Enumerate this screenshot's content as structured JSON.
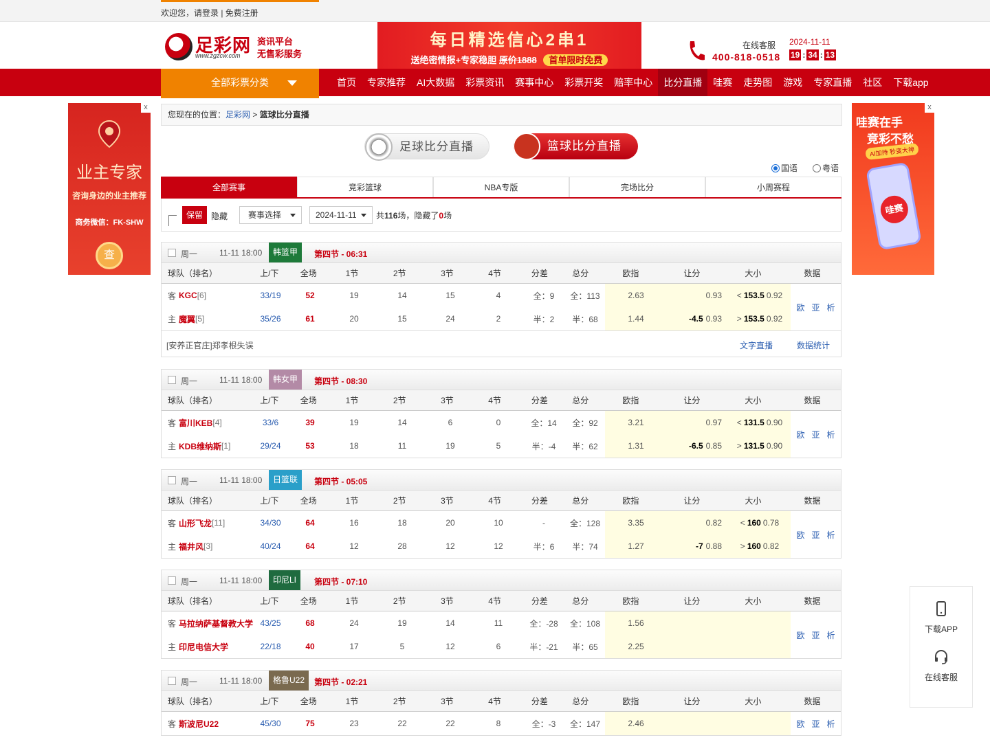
{
  "topbar": {
    "text": "欢迎您，请登录 | 免费注册"
  },
  "header": {
    "brand": "足彩网",
    "url": "www.zgzcw.com",
    "tag1": "资讯平台",
    "tag2": "无售彩服务",
    "banner_line1": "每日精选信心2串1",
    "banner_line2": "送绝密情报+专家稳胆",
    "banner_old_price": "原价1888",
    "banner_highlight": "首单限时免费",
    "service_label": "在线客服",
    "service_phone": "400-818-0518",
    "date": "2024-11-11",
    "clock_h": "19",
    "clock_m": "34",
    "clock_s": "13"
  },
  "nav": {
    "all_categories": "全部彩票分类",
    "items": [
      "首页",
      "专家推荐",
      "AI大数据",
      "彩票资讯",
      "赛事中心",
      "彩票开奖",
      "赔率中心",
      "比分直播",
      "哇赛",
      "走势图",
      "游戏",
      "专家直播",
      "社区",
      "下载app"
    ],
    "active_index": 7
  },
  "ad_left": {
    "close": "x",
    "title": "业主专家",
    "subtitle": "咨询身边的业主推荐",
    "wechat": "商务微信：FK-SHW",
    "coin": "查"
  },
  "ad_right": {
    "close": "x",
    "line1": "哇赛在手",
    "line2": "竞彩不愁",
    "line3": "AI加持 秒变大神",
    "app_logo": "哇赛"
  },
  "breadcrumb": {
    "prefix": "您现在的位置：",
    "home": "足彩网",
    "sep": ">",
    "current": "篮球比分直播"
  },
  "switches": {
    "football": "足球比分直播",
    "basketball": "篮球比分直播"
  },
  "radios": {
    "mandarin": "国语",
    "cantonese": "粤语"
  },
  "tabs": [
    "全部赛事",
    "竞彩篮球",
    "NBA专版",
    "完场比分",
    "小周赛程"
  ],
  "filter": {
    "keep": "保留",
    "hide": "隐藏",
    "event_select": "赛事选择",
    "date": "2024-11-11",
    "count_prefix": "共",
    "total": "116",
    "count_mid": "场，隐藏了",
    "hidden": "0",
    "count_suffix": "场"
  },
  "columns": [
    "球队（排名）",
    "上/下",
    "全场",
    "1节",
    "2节",
    "3节",
    "4节",
    "分差",
    "总分",
    "欧指",
    "让分",
    "大小",
    "数据"
  ],
  "data_links": [
    "欧",
    "亚",
    "析"
  ],
  "matches": [
    {
      "weekday": "周一",
      "time": "11-11 18:00",
      "league": "韩篮甲",
      "league_color": "#1e7a3a",
      "status": "第四节 - 06:31",
      "away": {
        "side": "客",
        "name": "KGC",
        "rank": "[6]",
        "ud": "33/19",
        "ft": "52",
        "q": [
          "19",
          "14",
          "15",
          "4"
        ],
        "diff": "全：9",
        "total": "全：113",
        "eu": "2.63",
        "rq_line": "",
        "rq_odds": "0.93",
        "dx_sign": "<",
        "dx_line": "153.5",
        "dx_odds": "0.92"
      },
      "home": {
        "side": "主",
        "name": "魔翼",
        "rank": "[5]",
        "ud": "35/26",
        "ft": "61",
        "q": [
          "20",
          "15",
          "24",
          "2"
        ],
        "diff": "半：2",
        "total": "半：68",
        "eu": "1.44",
        "rq_line": "-4.5",
        "rq_odds": "0.93",
        "dx_sign": ">",
        "dx_line": "153.5",
        "dx_odds": "0.92"
      },
      "note": "[安养正官庄]郑孝根失误",
      "link1": "文字直播",
      "link2": "数据统计"
    },
    {
      "weekday": "周一",
      "time": "11-11 18:00",
      "league": "韩女甲",
      "league_color": "#b38aa6",
      "status": "第四节 - 08:30",
      "away": {
        "side": "客",
        "name": "富川KEB",
        "rank": "[4]",
        "ud": "33/6",
        "ft": "39",
        "q": [
          "19",
          "14",
          "6",
          "0"
        ],
        "diff": "全：14",
        "total": "全：92",
        "eu": "3.21",
        "rq_line": "",
        "rq_odds": "0.97",
        "dx_sign": "<",
        "dx_line": "131.5",
        "dx_odds": "0.90"
      },
      "home": {
        "side": "主",
        "name": "KDB维纳斯",
        "rank": "[1]",
        "ud": "29/24",
        "ft": "53",
        "q": [
          "18",
          "11",
          "19",
          "5"
        ],
        "diff": "半：-4",
        "total": "半：62",
        "eu": "1.31",
        "rq_line": "-6.5",
        "rq_odds": "0.85",
        "dx_sign": ">",
        "dx_line": "131.5",
        "dx_odds": "0.90"
      }
    },
    {
      "weekday": "周一",
      "time": "11-11 18:00",
      "league": "日篮联",
      "league_color": "#2a9fc9",
      "status": "第四节 - 05:05",
      "away": {
        "side": "客",
        "name": "山形飞龙",
        "rank": "[11]",
        "ud": "34/30",
        "ft": "64",
        "q": [
          "16",
          "18",
          "20",
          "10"
        ],
        "diff": "-",
        "total": "全：128",
        "eu": "3.35",
        "rq_line": "",
        "rq_odds": "0.82",
        "dx_sign": "<",
        "dx_line": "160",
        "dx_odds": "0.78"
      },
      "home": {
        "side": "主",
        "name": "福井风",
        "rank": "[3]",
        "ud": "40/24",
        "ft": "64",
        "q": [
          "12",
          "28",
          "12",
          "12"
        ],
        "diff": "半：6",
        "total": "半：74",
        "eu": "1.27",
        "rq_line": "-7",
        "rq_odds": "0.88",
        "dx_sign": ">",
        "dx_line": "160",
        "dx_odds": "0.82"
      }
    },
    {
      "weekday": "周一",
      "time": "11-11 18:00",
      "league": "印尼LI",
      "league_color": "#1f6b3f",
      "status": "第四节 - 07:10",
      "away": {
        "side": "客",
        "name": "马拉纳萨基督教大学",
        "rank": "",
        "ud": "43/25",
        "ft": "68",
        "q": [
          "24",
          "19",
          "14",
          "11"
        ],
        "diff": "全：-28",
        "total": "全：108",
        "eu": "1.56",
        "rq_line": "",
        "rq_odds": "",
        "dx_sign": "",
        "dx_line": "",
        "dx_odds": ""
      },
      "home": {
        "side": "主",
        "name": "印尼电信大学",
        "rank": "",
        "ud": "22/18",
        "ft": "40",
        "q": [
          "17",
          "5",
          "12",
          "6"
        ],
        "diff": "半：-21",
        "total": "半：65",
        "eu": "2.25",
        "rq_line": "",
        "rq_odds": "",
        "dx_sign": "",
        "dx_line": "",
        "dx_odds": ""
      }
    },
    {
      "weekday": "周一",
      "time": "11-11 18:00",
      "league": "格鲁U22",
      "league_color": "#7a6a4f",
      "status": "第四节 - 02:21",
      "away": {
        "side": "客",
        "name": "斯波尼U22",
        "rank": "",
        "ud": "45/30",
        "ft": "75",
        "q": [
          "23",
          "22",
          "22",
          "8"
        ],
        "diff": "全：-3",
        "total": "全：147",
        "eu": "2.46",
        "rq_line": "",
        "rq_odds": "",
        "dx_sign": "",
        "dx_line": "",
        "dx_odds": ""
      }
    }
  ],
  "float_panel": {
    "download": "下载APP",
    "service": "在线客服"
  }
}
